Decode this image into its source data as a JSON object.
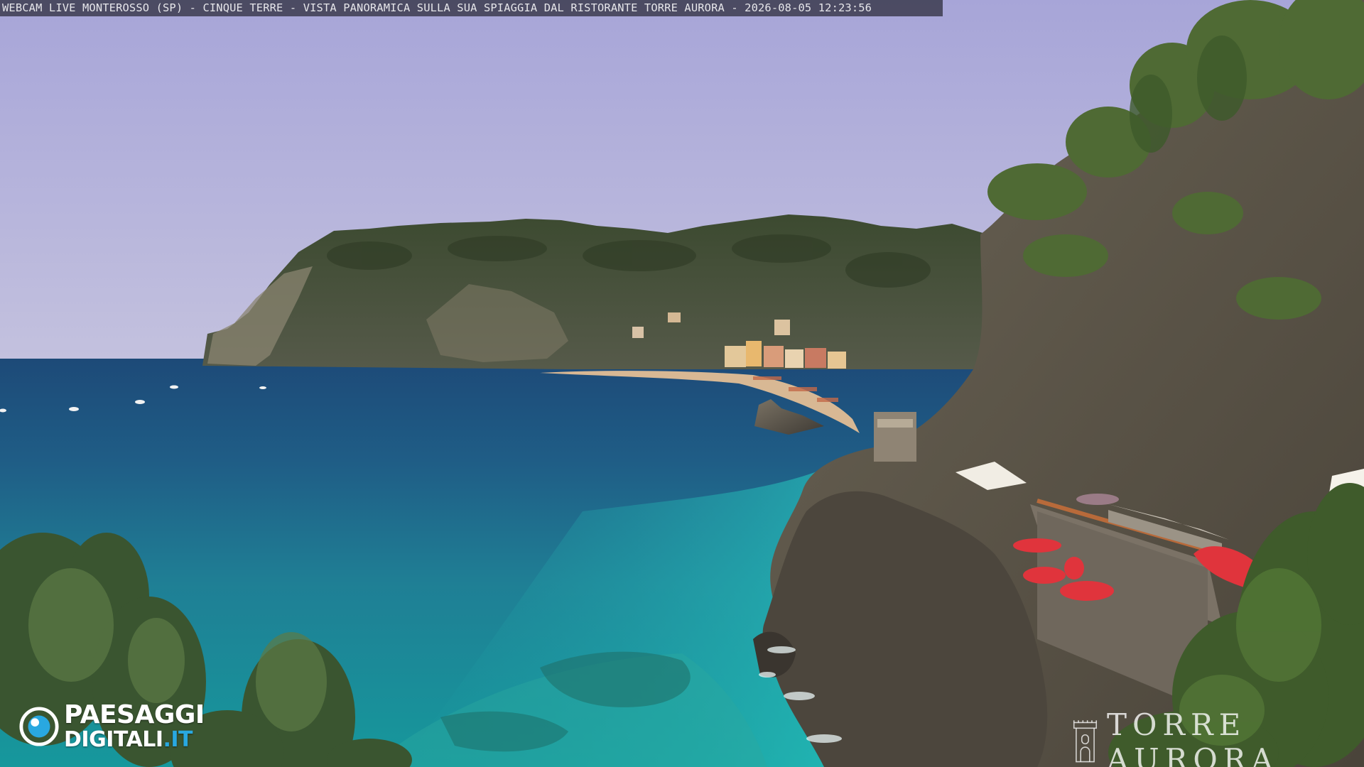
{
  "caption": {
    "text": "WEBCAM LIVE MONTEROSSO (SP) - CINQUE TERRE - VISTA PANORAMICA SULLA SUA SPIAGGIA DAL RISTORANTE TORRE AURORA - 2026-08-05 12:23:56"
  },
  "watermark_left": {
    "line1": "PAESAGGI",
    "line2_main": "DIGITALI",
    "line2_tld": ".IT",
    "icon": "camera-lens-icon"
  },
  "watermark_right": {
    "text": "TORRE AURORA",
    "icon": "tower-outline-icon"
  },
  "colors": {
    "sky": "#b4b2da",
    "sea_deep": "#1d4e78",
    "sea_turquoise": "#1fa0a8",
    "accent_blue": "#29a8e0",
    "umbrella_red": "#e0343c"
  }
}
